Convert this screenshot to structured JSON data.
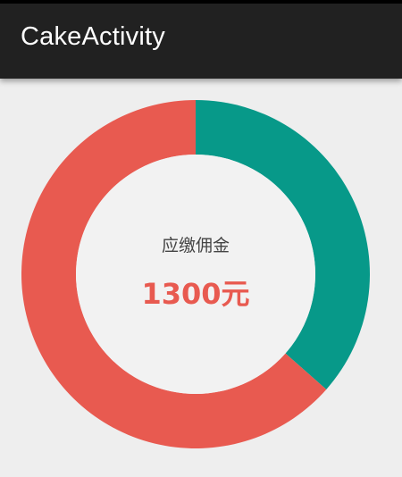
{
  "app_bar": {
    "title": "CakeActivity"
  },
  "donut": {
    "center_label": "应缴佣金",
    "center_amount": "1300元"
  },
  "chart_data": {
    "type": "pie",
    "categories": [
      "teal",
      "red"
    ],
    "values": [
      36.5,
      63.5
    ],
    "colors": [
      "#079989",
      "#e85a50"
    ],
    "center_fill": "#f2f2f2",
    "title": "",
    "start": "top, clockwise"
  }
}
